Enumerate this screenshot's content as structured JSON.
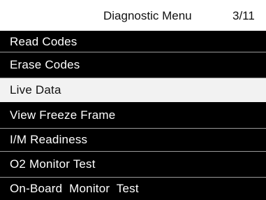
{
  "header": {
    "title": "Diagnostic Menu",
    "page_indicator": "3/11"
  },
  "menu": {
    "items": [
      {
        "label": "Read Codes",
        "selected": false
      },
      {
        "label": "Erase Codes",
        "selected": false
      },
      {
        "label": "Live Data",
        "selected": true
      },
      {
        "label": "View Freeze Frame",
        "selected": false
      },
      {
        "label": "I/M Readiness",
        "selected": false
      },
      {
        "label": "O2 Monitor Test",
        "selected": false
      },
      {
        "label": "On-Board  Monitor  Test",
        "selected": false
      }
    ]
  },
  "colors": {
    "background": "#000000",
    "header_background": "#ffffff",
    "selected_background": "#f2f2f2",
    "text_light": "#ffffff",
    "text_dark": "#111111",
    "divider": "#9a9a9a"
  }
}
